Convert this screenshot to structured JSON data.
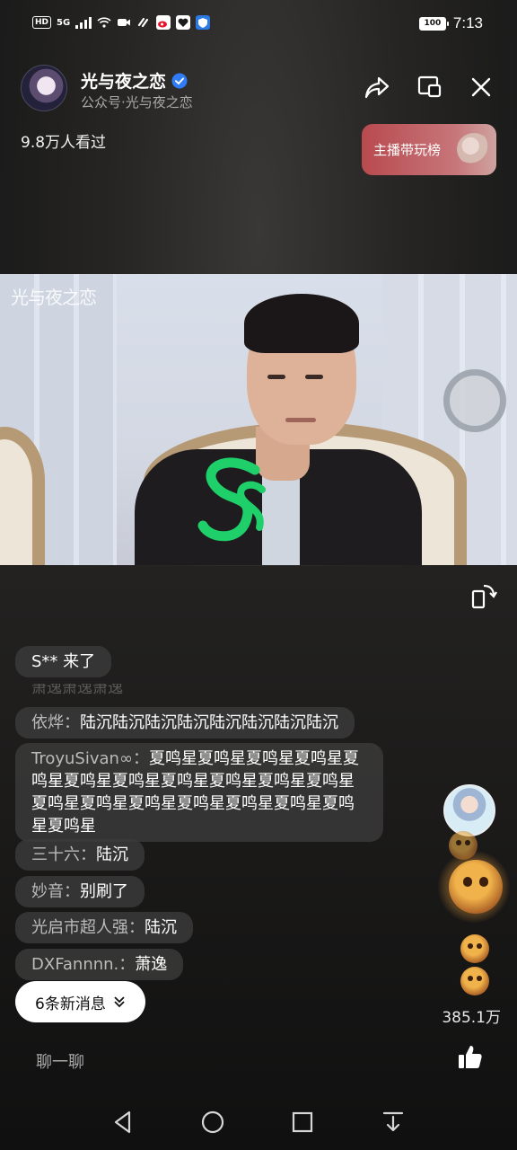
{
  "status_bar": {
    "network": "HD",
    "signal": "5G",
    "battery": "100",
    "time": "7:13"
  },
  "header": {
    "channel_name": "光与夜之恋",
    "channel_sub": "公众号·光与夜之恋",
    "views": "9.8万人看过",
    "rank_button": "主播带玩榜",
    "icons": [
      "share-icon",
      "minimize-window-icon",
      "close-icon"
    ]
  },
  "video": {
    "watermark": "光与夜之恋"
  },
  "comments": [
    {
      "user": "",
      "text": "S** 来了"
    },
    {
      "user": "依烨：",
      "text": "陆沉陆沉陆沉陆沉陆沉陆沉陆沉陆沉"
    },
    {
      "user": "TroyuSivan",
      "user_suffix": "：",
      "text": "夏鸣星夏鸣星夏鸣星夏鸣星夏鸣星夏鸣星夏鸣星夏鸣星夏鸣星夏鸣星夏鸣星夏鸣星夏鸣星夏鸣星夏鸣星夏鸣星夏鸣星夏鸣星夏鸣星"
    },
    {
      "user": "三十六：",
      "text": "陆沉"
    },
    {
      "user": "妙音：",
      "text": "别刷了"
    },
    {
      "user": "光启市超人强：",
      "text": "陆沉"
    },
    {
      "user": "DXFannnn.：",
      "text": "萧逸"
    }
  ],
  "faded_comment": "萧逸萧逸萧逸",
  "new_messages": "6条新消息",
  "likes": "385.1万",
  "chat_placeholder": "聊一聊",
  "nav": [
    "back-icon",
    "home-icon",
    "recents-icon",
    "notification-down-icon"
  ]
}
